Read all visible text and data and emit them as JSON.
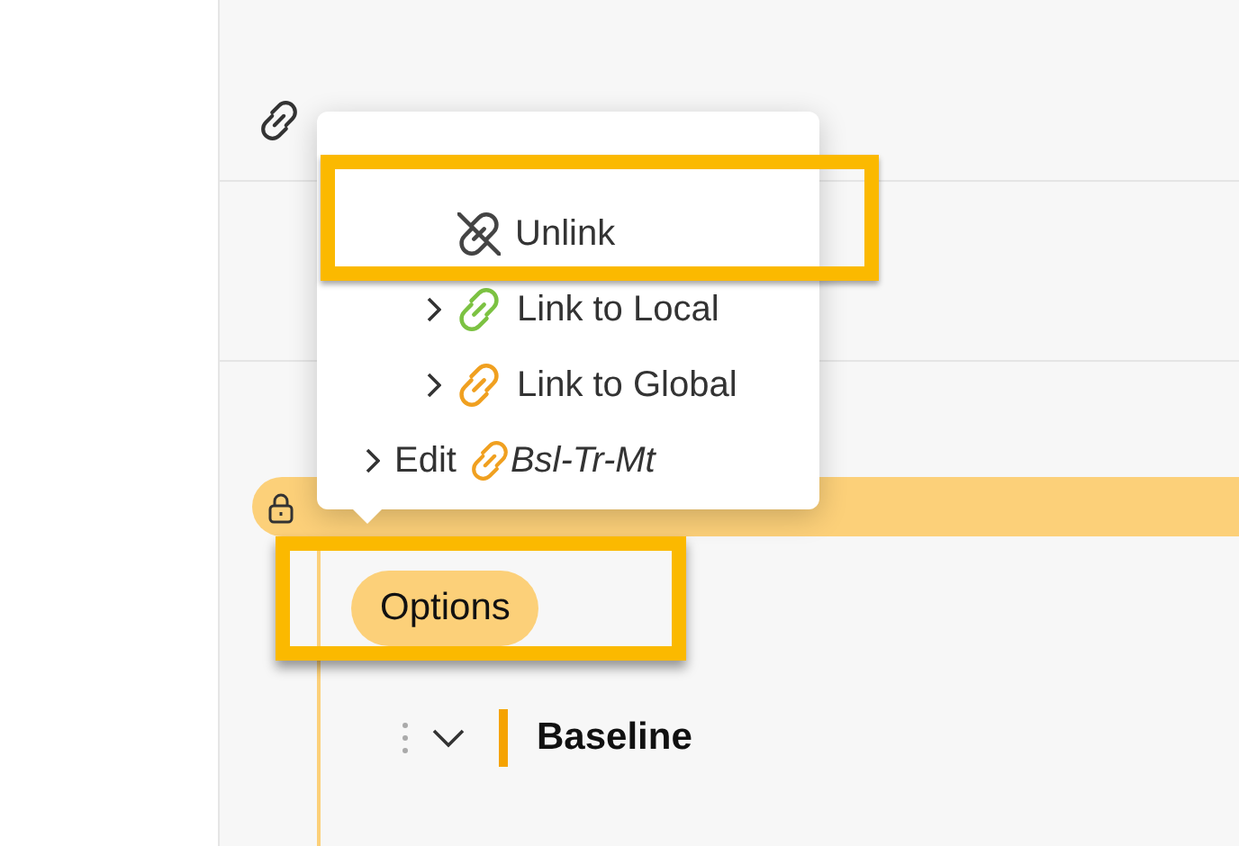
{
  "menu": {
    "items": [
      {
        "kind": "unlink",
        "label": "Unlink",
        "expandable": false
      },
      {
        "kind": "link",
        "label": "Link to Local",
        "expandable": true,
        "color": "#7cc242"
      },
      {
        "kind": "link",
        "label": "Link to Global",
        "expandable": true,
        "color": "#f0a020"
      },
      {
        "kind": "edit",
        "label": "Edit",
        "target": "Bsl-Tr-Mt",
        "expandable": true,
        "color": "#f0a020"
      }
    ]
  },
  "options_chip": "Options",
  "section": {
    "title": "Baseline",
    "expanded": true
  }
}
